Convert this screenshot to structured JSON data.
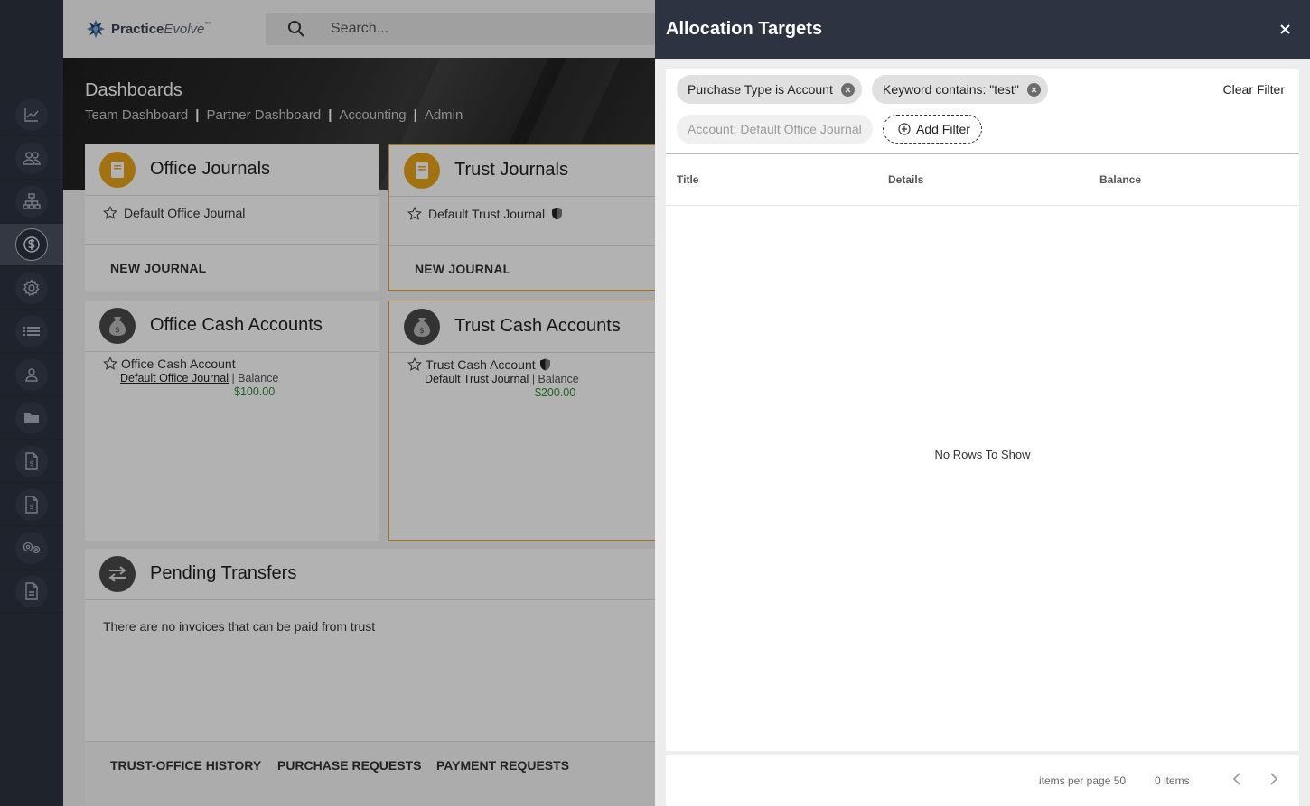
{
  "app": {
    "logo_text_bold": "Practice",
    "logo_text_italic": "Evolve",
    "logo_tm": "™",
    "search_placeholder": "Search..."
  },
  "sidebar": {
    "items": [
      {
        "icon": "chart-icon"
      },
      {
        "icon": "users-icon"
      },
      {
        "icon": "org-chart-icon"
      },
      {
        "icon": "dollar-icon",
        "active": true
      },
      {
        "icon": "gear-icon"
      },
      {
        "icon": "list-icon"
      },
      {
        "icon": "person-icon"
      },
      {
        "icon": "folder-icon"
      },
      {
        "icon": "invoice-icon"
      },
      {
        "icon": "invoice-icon"
      },
      {
        "icon": "gears-icon"
      },
      {
        "icon": "document-icon"
      }
    ]
  },
  "dashboard": {
    "title": "Dashboards",
    "breadcrumbs": [
      "Team Dashboard",
      "Partner Dashboard",
      "Accounting",
      "Admin"
    ],
    "breadcrumb_sep": "|"
  },
  "cards": {
    "office_journals": {
      "title": "Office Journals",
      "item": "Default Office Journal",
      "button": "NEW JOURNAL"
    },
    "trust_journals": {
      "title": "Trust Journals",
      "item": "Default Trust Journal",
      "button": "NEW JOURNAL"
    },
    "office_cash": {
      "title": "Office Cash Accounts",
      "account": "Office Cash Account",
      "journal_link": "Default Office Journal",
      "balance_label": " | Balance",
      "balance": "$100.00"
    },
    "trust_cash": {
      "title": "Trust Cash Accounts",
      "account": "Trust Cash Account",
      "journal_link": "Default Trust Journal",
      "balance_label": " | Balance",
      "balance": "$200.00"
    },
    "pending": {
      "title": "Pending Transfers",
      "message": "There are no invoices that can be paid from trust",
      "tabs": [
        "TRUST-OFFICE HISTORY",
        "PURCHASE REQUESTS",
        "PAYMENT REQUESTS"
      ]
    }
  },
  "panel": {
    "title": "Allocation Targets",
    "close": "×",
    "chips": [
      {
        "label": "Purchase Type is Account"
      },
      {
        "label": "Keyword contains: \"test\""
      }
    ],
    "disabled_chip": "Account: Default Office Journal",
    "add_filter": "Add Filter",
    "clear_filter": "Clear Filter",
    "columns": [
      "Title",
      "Details",
      "Balance"
    ],
    "empty_message": "No Rows To Show",
    "pager": {
      "items_per_page_label": "items per page",
      "items_per_page": "50",
      "count": "0 items"
    }
  },
  "colors": {
    "sidebar_bg": "#2d3340",
    "accent_gold": "#e8a317",
    "balance_green": "#2e8b2e"
  }
}
